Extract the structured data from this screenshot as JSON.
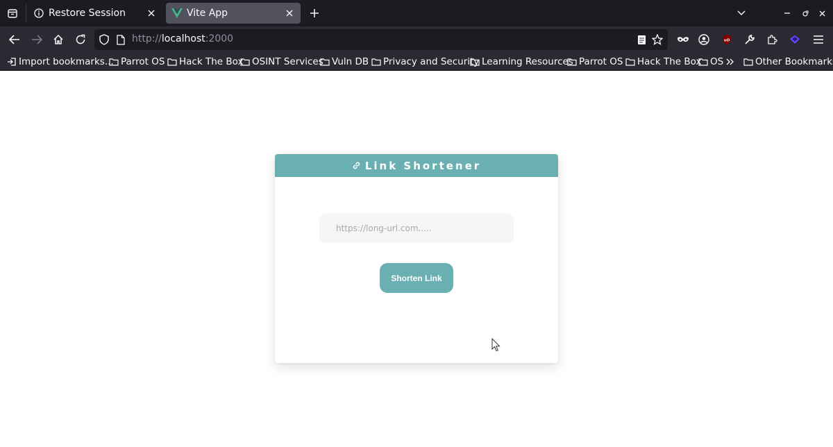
{
  "browser": {
    "tabs": [
      {
        "label": "Restore Session",
        "icon": "info-icon",
        "active": false
      },
      {
        "label": "Vite App",
        "icon": "vue-logo-icon",
        "active": true
      }
    ],
    "url": {
      "scheme": "http://",
      "host": "localhost",
      "port": ":2000"
    },
    "bookmarks": [
      {
        "label": "Import bookmarks...",
        "icon": "import-icon"
      },
      {
        "label": "Parrot OS",
        "icon": "folder-icon"
      },
      {
        "label": "Hack The Box",
        "icon": "folder-icon"
      },
      {
        "label": "OSINT Services",
        "icon": "folder-icon"
      },
      {
        "label": "Vuln DB",
        "icon": "folder-icon"
      },
      {
        "label": "Privacy and Security",
        "icon": "folder-icon"
      },
      {
        "label": "Learning Resources",
        "icon": "folder-icon"
      },
      {
        "label": "Parrot OS",
        "icon": "folder-icon"
      },
      {
        "label": "Hack The Box",
        "icon": "folder-icon"
      },
      {
        "label": "OS",
        "icon": "folder-icon"
      }
    ],
    "other_bookmarks": "Other Bookmarks"
  },
  "app": {
    "title": "Link Shortener",
    "input_placeholder": "https://long-url.com.....",
    "input_value": "",
    "button_label": "Shorten Link"
  },
  "colors": {
    "accent": "#6aafb1",
    "tab_bar": "#1c1b22",
    "toolbar": "#2b2a33",
    "input_bg": "#f6f6f6"
  }
}
